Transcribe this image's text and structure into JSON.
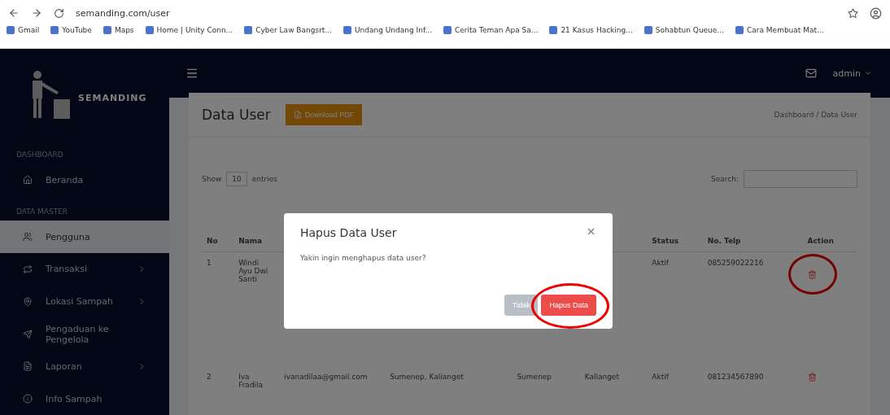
{
  "browser": {
    "url": "semanding.com/user",
    "bookmarks": [
      "Gmail",
      "YouTube",
      "Maps",
      "Home | Unity Conn...",
      "Cyber Law Bangsrt...",
      "Undang Undang Inf...",
      "Cerita Teman Apa Sa...",
      "21 Kasus Hacking...",
      "Sohabtun Queue...",
      "Cara Membuat Mat..."
    ]
  },
  "sidebar": {
    "brand": "SEMANDING",
    "sections": [
      {
        "heading": "DASHBOARD",
        "items": [
          {
            "label": "Beranda",
            "selected": false,
            "has_submenu": false
          }
        ]
      },
      {
        "heading": "DATA MASTER",
        "items": [
          {
            "label": "Pengguna",
            "selected": true,
            "has_submenu": false
          },
          {
            "label": "Transaksi",
            "selected": false,
            "has_submenu": true
          },
          {
            "label": "Lokasi Sampah",
            "selected": false,
            "has_submenu": true
          },
          {
            "label": "Pengaduan ke Pengelola",
            "selected": false,
            "has_submenu": false
          },
          {
            "label": "Laporan",
            "selected": false,
            "has_submenu": true
          },
          {
            "label": "Info Sampah",
            "selected": false,
            "has_submenu": false
          }
        ]
      }
    ]
  },
  "topbar": {
    "user": "admin"
  },
  "page": {
    "title": "Data User",
    "pdf_button": "Download PDF",
    "breadcrumb": "Dashboard / Data User"
  },
  "table": {
    "length_label": "Show",
    "length_value": "10",
    "length_suffix": "entries",
    "search_label": "Search:",
    "columns": [
      "No",
      "Nama",
      null,
      null,
      null,
      null,
      "Status",
      "No. Telp",
      "Action"
    ],
    "rows": [
      [
        "1",
        "Windi Ayu Dwi Santi",
        null,
        null,
        null,
        null,
        "Aktif",
        "085259022216"
      ],
      [
        "2",
        "Iva Fradila",
        "ivanadilaa@gmail.com",
        "Sumenep, Kalianget",
        "Sumenep",
        "Kalianget",
        "Aktif",
        "081234567890"
      ]
    ]
  },
  "modal": {
    "title": "Hapus Data User",
    "message": "Yakin ingin menghapus data user?",
    "buttons": [
      {
        "label": "Tidak",
        "kind": "secondary"
      },
      {
        "label": "Hapus Data",
        "kind": "danger",
        "circled": true
      }
    ]
  },
  "row_actions": [
    {
      "circled": true
    },
    {
      "circled": false
    }
  ]
}
